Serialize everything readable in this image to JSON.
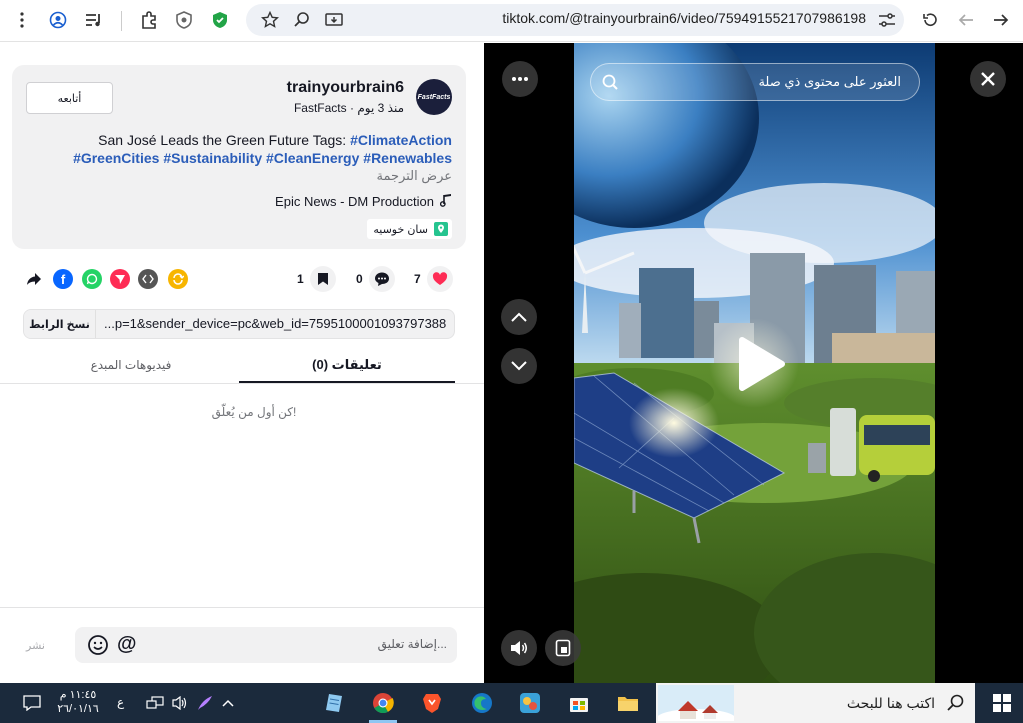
{
  "browser": {
    "url": "tiktok.com/@trainyourbrain6/video/7594915521707986198"
  },
  "post": {
    "follow_label": "أتابعه",
    "username": "trainyourbrain6",
    "meta": "FastFacts · منذ 3 يوم",
    "avatar_text": "FastFacts",
    "description_line1_text": "San José Leads the Green Future Tags:",
    "description_line1_tag": "#ClimateAction",
    "description_line2_tags": "#GreenCities #Sustainability #CleanEnergy #Renewables",
    "translate_label": "عرض الترجمة",
    "music": "Epic News - DM Production",
    "location": "سان خوسيه"
  },
  "actions": {
    "likes": "7",
    "comments": "0",
    "saves": "1"
  },
  "share_link": {
    "copy_label": "نسخ الرابط",
    "link": "...p=1&sender_device=pc&web_id=7595100001093797388"
  },
  "tabs": {
    "comments": "(0) تعليقات",
    "creator_videos": "فيديوهات المبدع"
  },
  "comments": {
    "empty_text": "كن أول من يُعلّق!",
    "input_placeholder": "إضافة تعليق...",
    "post_label": "نشر"
  },
  "video": {
    "search_placeholder": "العثور على محتوى ذي صلة"
  },
  "taskbar": {
    "search_placeholder": "اكتب هنا للبحث",
    "time": "١١:٤٥ م",
    "date": "٢٦/٠١/١٦",
    "lang": "ع"
  },
  "colors": {
    "tiktok_red": "#fe2c55",
    "tag_blue": "#2b5db9",
    "taskbar_bg": "#1b2a3c"
  }
}
